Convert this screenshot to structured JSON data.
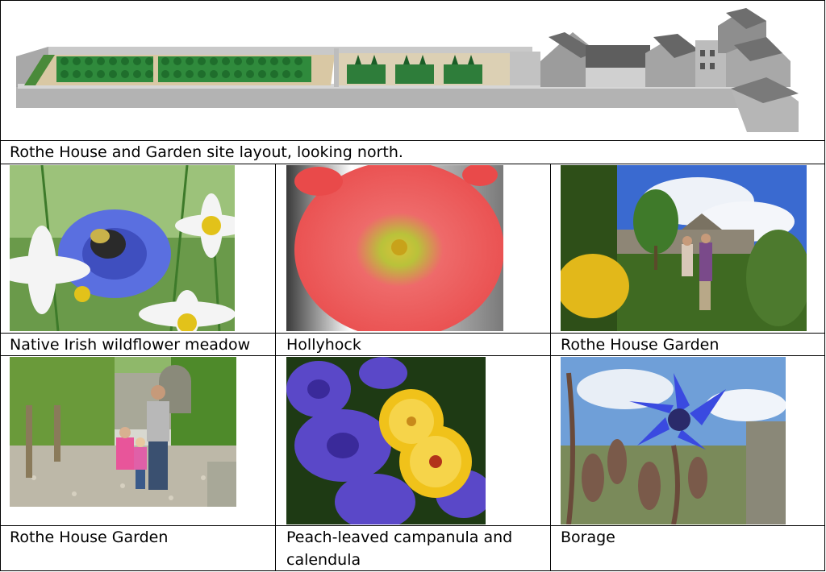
{
  "document": {
    "site_caption": "Rothe House and Garden site layout, looking north.",
    "photos": [
      {
        "caption": "Native Irish wildflower meadow",
        "subject": "cornflower-and-daisies-with-bee"
      },
      {
        "caption": "Hollyhock",
        "subject": "pink-hollyhock"
      },
      {
        "caption": "Rothe House Garden",
        "subject": "couple-in-garden"
      },
      {
        "caption": "Rothe House Garden",
        "subject": "family-on-garden-path"
      },
      {
        "caption": "Peach-leaved campanula and calendula",
        "caption_line1": "Peach-leaved campanula and",
        "caption_line2": "calendula",
        "subject": "campanula-and-calendula"
      },
      {
        "caption": "Borage",
        "subject": "borage-flower"
      }
    ]
  }
}
